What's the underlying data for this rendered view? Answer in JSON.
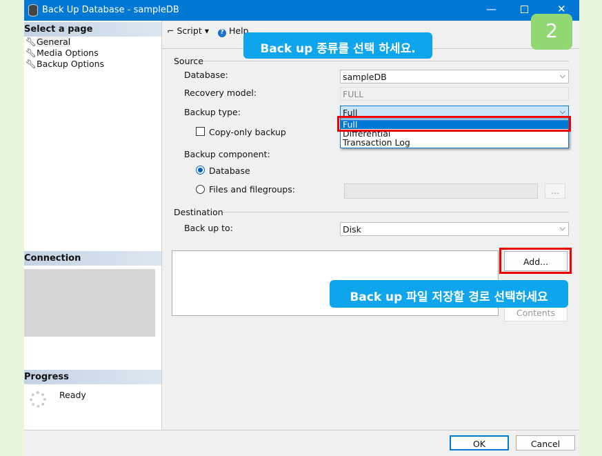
{
  "window": {
    "title": "Back Up Database - sampleDB",
    "controls": [
      "minimize",
      "maximize",
      "close"
    ]
  },
  "step_badge": "2",
  "left": {
    "select_page": "Select a page",
    "pages": [
      {
        "label": "General",
        "icon": "wrench-icon"
      },
      {
        "label": "Media Options",
        "icon": "wrench-icon"
      },
      {
        "label": "Backup Options",
        "icon": "wrench-icon"
      }
    ],
    "connection": "Connection",
    "progress": "Progress",
    "progress_status": "Ready"
  },
  "toolbar": {
    "script": "Script",
    "help": "Help"
  },
  "callouts": {
    "top": "Back up 종류를 선택 하세요.",
    "bottom": "Back up 파일 저장할 경로 선택하세요"
  },
  "source": {
    "title": "Source",
    "database_label": "Database:",
    "database_value": "sampleDB",
    "recovery_label": "Recovery model:",
    "recovery_value": "FULL",
    "backup_type_label": "Backup type:",
    "backup_type_value": "Full",
    "backup_type_options": [
      "Full",
      "Differential",
      "Transaction Log"
    ],
    "copy_only": "Copy-only backup",
    "component_label": "Backup component:",
    "component_database": "Database",
    "component_files": "Files and filegroups:",
    "browse": "..."
  },
  "destination": {
    "title": "Destination",
    "backup_to_label": "Back up to:",
    "backup_to_value": "Disk",
    "add": "Add...",
    "contents": "Contents"
  },
  "footer": {
    "ok": "OK",
    "cancel": "Cancel"
  }
}
